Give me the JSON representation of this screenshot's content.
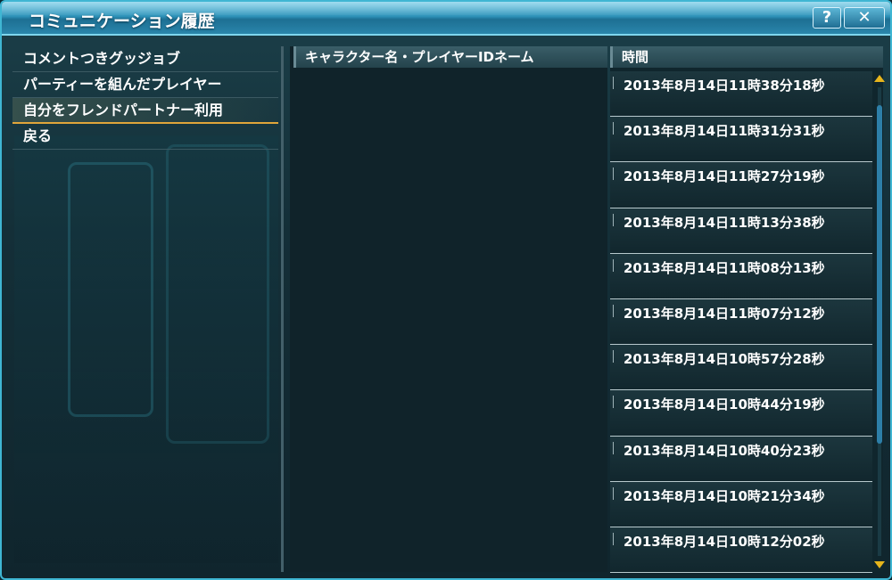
{
  "window": {
    "title": "コミュニケーション履歴",
    "help_label": "?",
    "close_label": "✕"
  },
  "menu": {
    "items": [
      {
        "label": "コメントつきグッジョブ"
      },
      {
        "label": "パーティーを組んだプレイヤー"
      },
      {
        "label": "自分をフレンドパートナー利用"
      },
      {
        "label": "戻る"
      }
    ],
    "selected_index": 2
  },
  "columns": {
    "character_header": "キャラクター名・プレイヤーIDネーム",
    "time_header": "時間"
  },
  "rows": [
    {
      "character": "",
      "time": "2013年8月14日11時38分18秒"
    },
    {
      "character": "",
      "time": "2013年8月14日11時31分31秒"
    },
    {
      "character": "",
      "time": "2013年8月14日11時27分19秒"
    },
    {
      "character": "",
      "time": "2013年8月14日11時13分38秒"
    },
    {
      "character": "",
      "time": "2013年8月14日11時08分13秒"
    },
    {
      "character": "",
      "time": "2013年8月14日11時07分12秒"
    },
    {
      "character": "",
      "time": "2013年8月14日10時57分28秒"
    },
    {
      "character": "",
      "time": "2013年8月14日10時44分19秒"
    },
    {
      "character": "",
      "time": "2013年8月14日10時40分23秒"
    },
    {
      "character": "",
      "time": "2013年8月14日10時21分34秒"
    },
    {
      "character": "",
      "time": "2013年8月14日10時12分02秒"
    }
  ],
  "colors": {
    "titlebar": "#2f93b9",
    "selection_underline": "#e0a53a",
    "scroll_arrow": "#e7b51c"
  },
  "icons": {
    "help": "question-icon",
    "close": "close-icon",
    "scroll_up": "arrow-up-icon",
    "scroll_down": "arrow-down-icon"
  }
}
